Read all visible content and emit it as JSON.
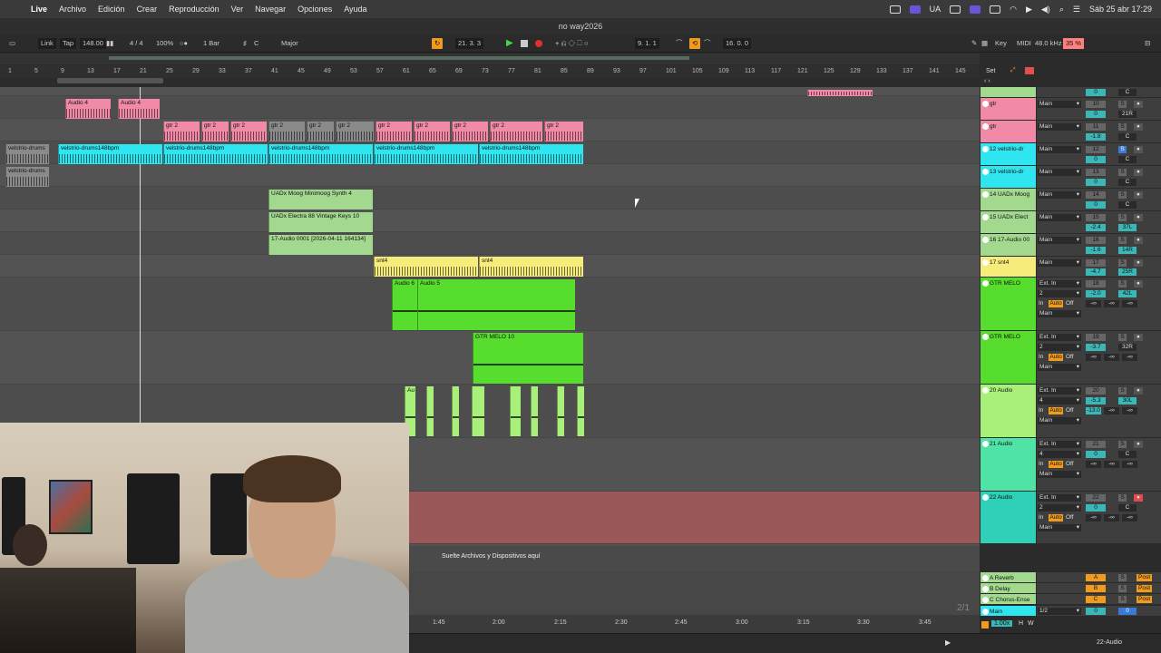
{
  "menubar": {
    "app": "Live",
    "items": [
      "Archivo",
      "Edición",
      "Crear",
      "Reproducción",
      "Ver",
      "Navegar",
      "Opciones",
      "Ayuda"
    ],
    "input_source": "UA",
    "datetime": "Sáb 25 abr  17:29"
  },
  "title": "no way2026",
  "control": {
    "link": "Link",
    "tap": "Tap",
    "tempo": "148.00",
    "signature": "4 / 4",
    "zoom": "100%",
    "quantize": "1 Bar",
    "key": "C",
    "scale": "Major",
    "arrangement_position": "21.  3.  3",
    "loop_start": "9.  1.  1",
    "loop_length": "16.  0.  0",
    "key_map": "Key",
    "midi_map": "MIDI",
    "sample_rate": "48.0 kHz",
    "cpu": "35 %"
  },
  "ruler": [
    "1",
    "5",
    "9",
    "13",
    "17",
    "21",
    "25",
    "29",
    "33",
    "37",
    "41",
    "45",
    "49",
    "53",
    "57",
    "61",
    "65",
    "69",
    "73",
    "77",
    "81",
    "85",
    "89",
    "93",
    "97",
    "101",
    "105",
    "109",
    "113",
    "117",
    "121",
    "125",
    "129",
    "133",
    "137",
    "141",
    "145"
  ],
  "set_label": "Set",
  "clips": {
    "audio4a": "Audio 4",
    "audio4b": "Audio 4",
    "gtr": "gtr 2",
    "drums": "velstrio-drums148bpm",
    "drums_short": "velstrio-drums",
    "moog": "UADx Moog Minimoog Synth 4",
    "electra": "UADx Electra 88 Vintage Keys 10",
    "audio17": "17-Audio 0001 [2026-04-11 164134]",
    "snt4a": "snt4",
    "snt4b": "snt4",
    "audio6": "Audio 6",
    "audio5": "Audio 5",
    "gtrmelo": "GTR MELO 10",
    "au": "Au"
  },
  "tracks": [
    {
      "name": "gtr",
      "num": "10",
      "vol": "0",
      "pan": "21R",
      "out": "Main"
    },
    {
      "name": "gtr",
      "num": "11",
      "vol": "-1.8",
      "pan": "C",
      "out": "Main"
    },
    {
      "name": "12 velstrio-dr",
      "num": "12",
      "vol": "0",
      "pan": "C",
      "out": "Main"
    },
    {
      "name": "13 velstrio-dr",
      "num": "13",
      "vol": "0",
      "pan": "C",
      "out": "Main"
    },
    {
      "name": "14 UADx Moog",
      "num": "14",
      "vol": "0",
      "pan": "C",
      "out": "Main"
    },
    {
      "name": "15 UADx Elect",
      "num": "15",
      "vol": "-2.4",
      "pan": "37L",
      "out": "Main"
    },
    {
      "name": "16 17-Audio 00",
      "num": "16",
      "vol": "-1.6",
      "pan": "14R",
      "out": "Main"
    },
    {
      "name": "17 snt4",
      "num": "17",
      "vol": "-4.7",
      "pan": "25R",
      "out": "Main"
    },
    {
      "name": "GTR MELO",
      "num": "18",
      "vol": "-2.0",
      "pan": "42L",
      "in": "Ext. In",
      "ch": "2",
      "out": "Main"
    },
    {
      "name": "GTR MELO",
      "num": "19",
      "vol": "-3.7",
      "pan": "32R",
      "in": "Ext. In",
      "ch": "2",
      "out": "Main"
    },
    {
      "name": "20 Audio",
      "num": "20",
      "vol": "-5.3",
      "pan": "30L",
      "in": "Ext. In",
      "ch": "4",
      "out": "Main",
      "send": "-13.0"
    },
    {
      "name": "21 Audio",
      "num": "21",
      "vol": "0",
      "pan": "C",
      "in": "Ext. In",
      "ch": "4",
      "out": "Main"
    },
    {
      "name": "22 Audio",
      "num": "22",
      "vol": "0",
      "pan": "C",
      "in": "Ext. In",
      "ch": "2",
      "out": "Main"
    }
  ],
  "returns": [
    {
      "name": "A Reverb",
      "letter": "A",
      "post": "Post"
    },
    {
      "name": "B Delay",
      "letter": "B",
      "post": "Post"
    },
    {
      "name": "C Chorus-Ense",
      "letter": "C",
      "post": "Post"
    }
  ],
  "main_track": {
    "name": "Main",
    "out": "1/2",
    "vol": "0",
    "pan": "0"
  },
  "mixer_labels": {
    "s": "S",
    "c": "C",
    "in": "In",
    "auto": "Auto",
    "off": "Off",
    "inf": "-∞"
  },
  "drop_text": "Suelte Archivos y Dispositivos aquí",
  "time_ruler": [
    "1:45",
    "2:00",
    "2:15",
    "2:30",
    "2:45",
    "3:00",
    "3:15",
    "3:30",
    "3:45"
  ],
  "page_indicator": "2/1",
  "bottom": {
    "zoom": "1.00x",
    "h": "H",
    "w": "W",
    "selected_track": "22-Audio"
  },
  "colors": {
    "pink": "#f08aa6",
    "cyan": "#2fe6f0",
    "green": "#57dd2e",
    "lightgreen": "#a2d98f",
    "yellow": "#f5ec7c",
    "red": "#9a5858",
    "orange": "#f09a1e"
  }
}
